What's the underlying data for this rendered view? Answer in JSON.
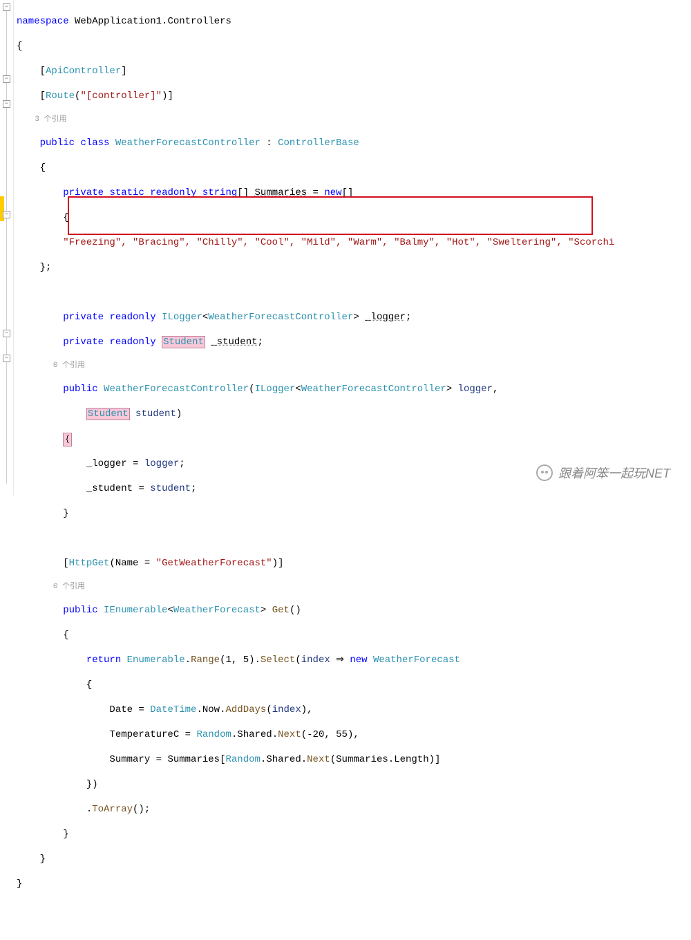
{
  "code": {
    "ns_kw": "namespace",
    "ns_name": "WebApplication1.Controllers",
    "open_brace": "{",
    "close_brace": "}",
    "attr_api": "ApiController",
    "attr_route_open": "Route",
    "attr_route_str": "\"[controller]\"",
    "codelens_class": "3 个引用",
    "public": "public",
    "class": "class",
    "class_name": "WeatherForecastController",
    "colon": " : ",
    "base_class": "ControllerBase",
    "private": "private",
    "static": "static",
    "readonly": "readonly",
    "string_type": "string",
    "summaries_field": "Summaries",
    "equals": " = ",
    "new": "new",
    "summaries_values": "\"Freezing\", \"Bracing\", \"Chilly\", \"Cool\", \"Mild\", \"Warm\", \"Balmy\", \"Hot\", \"Sweltering\", \"Scorchi",
    "close_array": "};",
    "ilogger": "ILogger",
    "lt": "<",
    "gt": ">",
    "logger_field": "_logger",
    "student_type": "Student",
    "student_field": "_student",
    "semicolon": ";",
    "codelens_ctor": "0 个引用",
    "ctor_name": "WeatherForecastController",
    "logger_param": "logger",
    "student_param": "student",
    "logger_assign_l": "_logger",
    "logger_assign_r": "logger",
    "student_assign_l": "_student",
    "student_assign_r": "student",
    "httpget": "HttpGet",
    "name_prop": "Name",
    "getweather_str": "\"GetWeatherForecast\"",
    "codelens_get": "0 个引用",
    "ienumerable": "IEnumerable",
    "weatherforecast": "WeatherForecast",
    "get_method": "Get",
    "return": "return",
    "enumerable": "Enumerable",
    "range": "Range",
    "range_args": "(1, 5)",
    "select": "Select",
    "index": "index",
    "arrow": " ⇒ ",
    "date_prop": "Date",
    "datetime": "DateTime",
    "now": "Now",
    "adddays": "AddDays",
    "adddays_arg": "index",
    "temp_prop": "TemperatureC",
    "random": "Random",
    "shared": "Shared",
    "next": "Next",
    "next_args1": "(-20, 55)",
    "summary_prop": "Summary",
    "summaries_ref": "Summaries",
    "length": "Length",
    "close_init": "})",
    "toarray": "ToArray",
    "empty_parens": "()",
    "comma": ","
  },
  "watermark": {
    "text": "跟着阿笨一起玩NET"
  }
}
